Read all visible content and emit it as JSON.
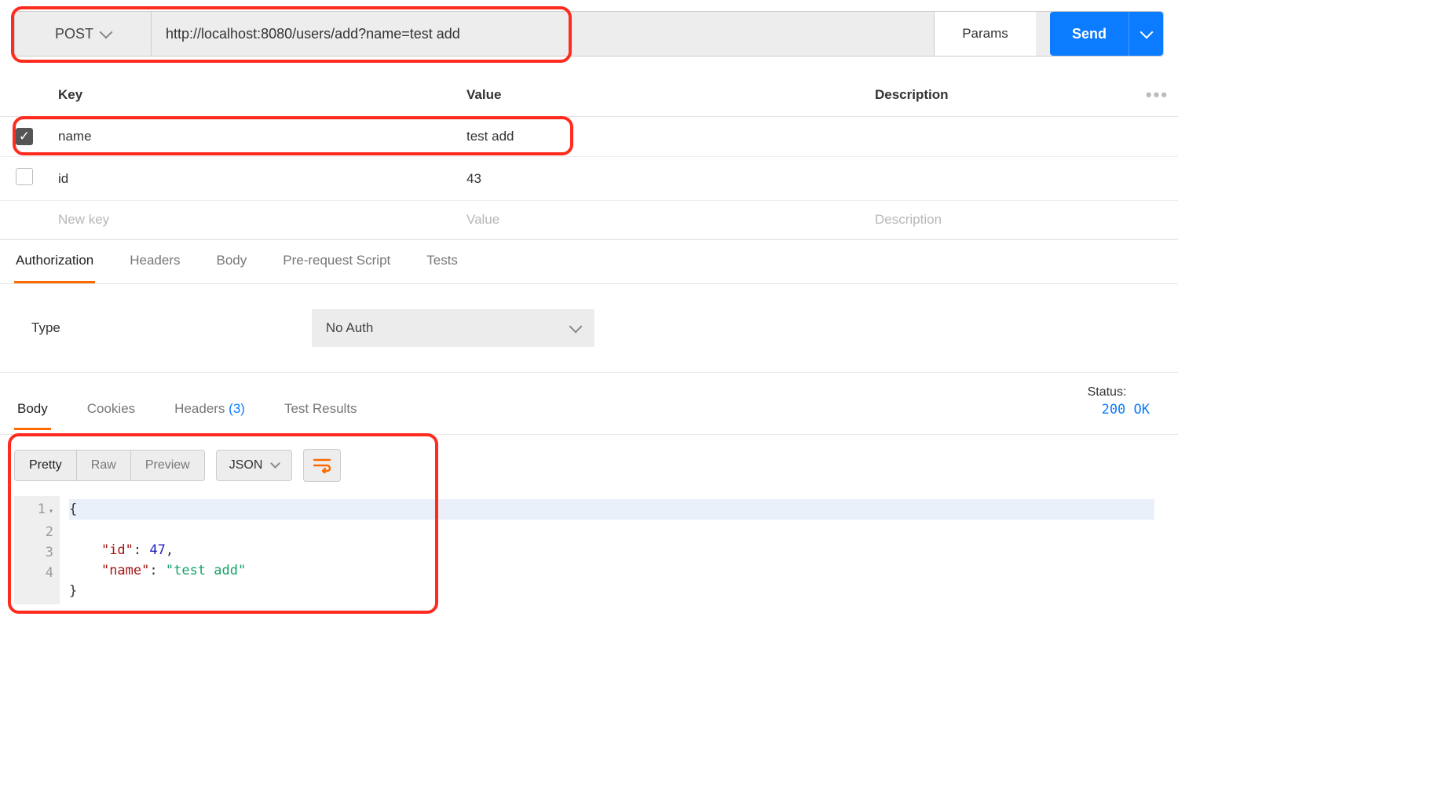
{
  "request": {
    "method": "POST",
    "url": "http://localhost:8080/users/add?name=test add",
    "params_button": "Params",
    "send_button": "Send"
  },
  "params_table": {
    "headers": {
      "key": "Key",
      "value": "Value",
      "desc": "Description"
    },
    "rows": [
      {
        "enabled": true,
        "key": "name",
        "value": "test add",
        "desc": ""
      },
      {
        "enabled": false,
        "key": "id",
        "value": "43",
        "desc": ""
      }
    ],
    "placeholder": {
      "key": "New key",
      "value": "Value",
      "desc": "Description"
    }
  },
  "request_tabs": [
    "Authorization",
    "Headers",
    "Body",
    "Pre-request Script",
    "Tests"
  ],
  "request_tab_active": "Authorization",
  "auth": {
    "label": "Type",
    "selected": "No Auth"
  },
  "response_tabs": {
    "items": [
      "Body",
      "Cookies",
      "Headers",
      "Test Results"
    ],
    "headers_count": "(3)",
    "active": "Body"
  },
  "status": {
    "label": "Status:",
    "code": "200 OK"
  },
  "body_view": {
    "modes": [
      "Pretty",
      "Raw",
      "Preview"
    ],
    "mode_active": "Pretty",
    "format": "JSON"
  },
  "response_body_lines": [
    "{",
    "    \"id\": 47,",
    "    \"name\": \"test add\"",
    "}"
  ]
}
